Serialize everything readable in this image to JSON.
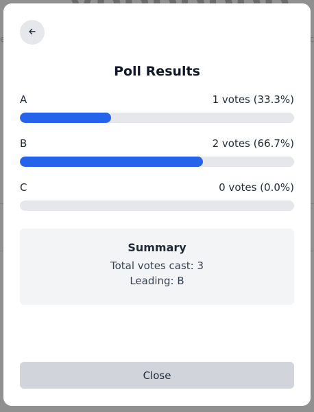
{
  "dialog": {
    "title": "Poll Results",
    "close_label": "Close"
  },
  "options": [
    {
      "label": "A",
      "result": "1 votes (33.3%)",
      "fraction": 0.333
    },
    {
      "label": "B",
      "result": "2 votes (66.7%)",
      "fraction": 0.667
    },
    {
      "label": "C",
      "result": "0 votes (0.0%)",
      "fraction": 0.0
    }
  ],
  "summary": {
    "title": "Summary",
    "total": "Total votes cast: 3",
    "leading": "Leading: B"
  },
  "colors": {
    "accent": "#2563eb",
    "track": "#e5e7eb",
    "summary_bg": "#f3f4f6",
    "button_bg": "#d1d5db"
  },
  "icons": {
    "back": "arrow-left-icon"
  }
}
